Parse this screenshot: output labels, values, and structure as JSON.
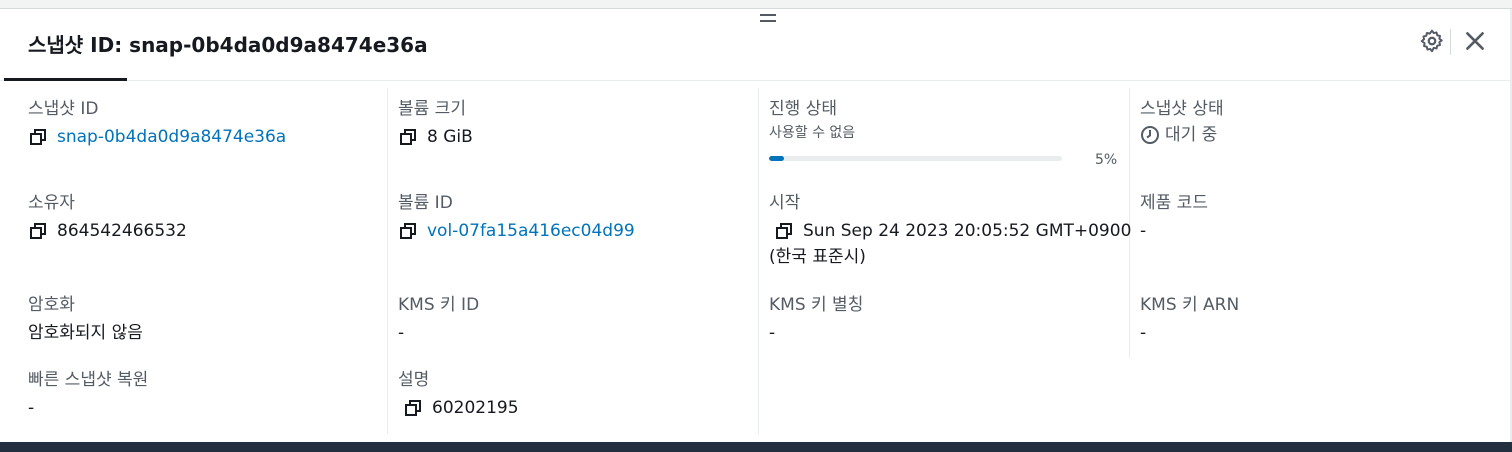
{
  "header": {
    "title": "스냅샷 ID: snap-0b4da0d9a8474e36a",
    "settings_icon": "gear-icon",
    "close_icon": "close-icon"
  },
  "fields": {
    "snapshot_id": {
      "label": "스냅샷 ID",
      "value": "snap-0b4da0d9a8474e36a"
    },
    "volume_size": {
      "label": "볼륨 크기",
      "value": "8 GiB"
    },
    "progress": {
      "label": "진행 상태",
      "sub": "사용할 수 없음",
      "percent_label": "5%",
      "fraction": 0.05
    },
    "snapshot_state": {
      "label": "스냅샷 상태",
      "value": "대기 중"
    },
    "owner": {
      "label": "소유자",
      "value": "864542466532"
    },
    "volume_id": {
      "label": "볼륨 ID",
      "value": "vol-07fa15a416ec04d99"
    },
    "started": {
      "label": "시작",
      "value": "Sun Sep 24 2023 20:05:52 GMT+0900",
      "value2": "(한국 표준시)"
    },
    "product_code": {
      "label": "제품 코드",
      "value": "-"
    },
    "encryption": {
      "label": "암호화",
      "value": "암호화되지 않음"
    },
    "kms_key_id": {
      "label": "KMS 키 ID",
      "value": "-"
    },
    "kms_alias": {
      "label": "KMS 키 별칭",
      "value": "-"
    },
    "kms_arn": {
      "label": "KMS 키 ARN",
      "value": "-"
    },
    "fast_restore": {
      "label": "빠른 스냅샷 복원",
      "value": "-"
    },
    "description": {
      "label": "설명",
      "value": "60202195"
    }
  },
  "colors": {
    "link": "#0073bb",
    "label": "#545b64",
    "progress_fill": "#0073bb",
    "footer": "#232f3e"
  }
}
